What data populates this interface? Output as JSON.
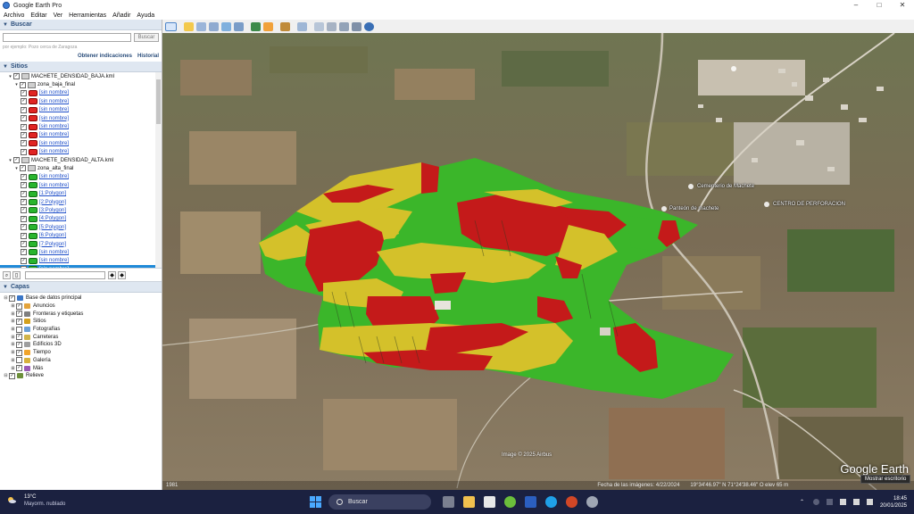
{
  "window": {
    "title": "Google Earth Pro"
  },
  "menu": [
    "Archivo",
    "Editar",
    "Ver",
    "Herramientas",
    "Añadir",
    "Ayuda"
  ],
  "search": {
    "header": "Buscar",
    "button": "Buscar",
    "placeholder": "",
    "hint": "por ejemplo: Pozo cerca de Zaragoza",
    "directions": "Obtener indicaciones",
    "history": "Historial"
  },
  "places": {
    "header": "Sitios",
    "tree": [
      {
        "label": "MACHETE_DENSIDAD_BAJA.kml",
        "indent": 1,
        "type": "kml"
      },
      {
        "label": "zona_baja_final",
        "indent": 2,
        "type": "folder"
      },
      {
        "label": "[sin nombre]",
        "indent": 3,
        "color": "red"
      },
      {
        "label": "[sin nombre]",
        "indent": 3,
        "color": "red"
      },
      {
        "label": "[sin nombre]",
        "indent": 3,
        "color": "red"
      },
      {
        "label": "[sin nombre]",
        "indent": 3,
        "color": "red"
      },
      {
        "label": "[sin nombre]",
        "indent": 3,
        "color": "red"
      },
      {
        "label": "[sin nombre]",
        "indent": 3,
        "color": "red"
      },
      {
        "label": "[sin nombre]",
        "indent": 3,
        "color": "red"
      },
      {
        "label": "[sin nombre]",
        "indent": 3,
        "color": "red"
      },
      {
        "label": "MACHETE_DENSIDAD_ALTA.kml",
        "indent": 1,
        "type": "kml"
      },
      {
        "label": "zona_alta_final",
        "indent": 2,
        "type": "folder"
      },
      {
        "label": "[sin nombre]",
        "indent": 3,
        "color": "green"
      },
      {
        "label": "[sin nombre]",
        "indent": 3,
        "color": "green"
      },
      {
        "label": "[1:Polygon]",
        "indent": 3,
        "color": "green"
      },
      {
        "label": "[2:Polygon]",
        "indent": 3,
        "color": "green"
      },
      {
        "label": "[3:Polygon]",
        "indent": 3,
        "color": "green"
      },
      {
        "label": "[4:Polygon]",
        "indent": 3,
        "color": "green"
      },
      {
        "label": "[5:Polygon]",
        "indent": 3,
        "color": "green"
      },
      {
        "label": "[6:Polygon]",
        "indent": 3,
        "color": "green"
      },
      {
        "label": "[7:Polygon]",
        "indent": 3,
        "color": "green"
      },
      {
        "label": "[sin nombre]",
        "indent": 3,
        "color": "green"
      },
      {
        "label": "[sin nombre]",
        "indent": 3,
        "color": "green"
      },
      {
        "label": "[sin nombre]",
        "indent": 3,
        "color": "green",
        "selected": true
      }
    ]
  },
  "layers": {
    "header": "Capas",
    "items": [
      {
        "label": "Base de datos principal",
        "indent": 0,
        "icon": "globe-icon"
      },
      {
        "label": "Anuncios",
        "indent": 1,
        "icon": "megaphone-icon"
      },
      {
        "label": "Fronteras y etiquetas",
        "indent": 1,
        "icon": "borders-icon"
      },
      {
        "label": "Sitios",
        "indent": 1,
        "icon": "place-icon"
      },
      {
        "label": "Fotografías",
        "indent": 1,
        "icon": "photo-icon"
      },
      {
        "label": "Carreteras",
        "indent": 1,
        "icon": "road-icon"
      },
      {
        "label": "Edificios 3D",
        "indent": 1,
        "icon": "building-icon"
      },
      {
        "label": "Tiempo",
        "indent": 1,
        "icon": "weather-icon"
      },
      {
        "label": "Galería",
        "indent": 1,
        "icon": "gallery-icon"
      },
      {
        "label": "Más",
        "indent": 1,
        "icon": "more-icon"
      },
      {
        "label": "Relieve",
        "indent": 0,
        "icon": "terrain-icon"
      }
    ]
  },
  "map": {
    "labels": {
      "cemetery": "Cementerio de Machete",
      "panteon": "Panteón de machete",
      "center": "CENTRO DE PERFORACION"
    },
    "copyright": "Image © 2025 Airbus",
    "logo": "Google Earth",
    "compass_n": "N",
    "status": {
      "date": "Fecha de las imágenes: 4/22/2024",
      "coords": "19°34'46.97\" N  71°24'38.46\" O  elev  65 m",
      "alt": "1981"
    },
    "tooltip": "Mostrar escritorio"
  },
  "taskbar": {
    "temperature": "13°C",
    "condition": "Mayorm. nublado",
    "search": "Buscar",
    "time": "18:45",
    "date": "20/01/2025"
  }
}
